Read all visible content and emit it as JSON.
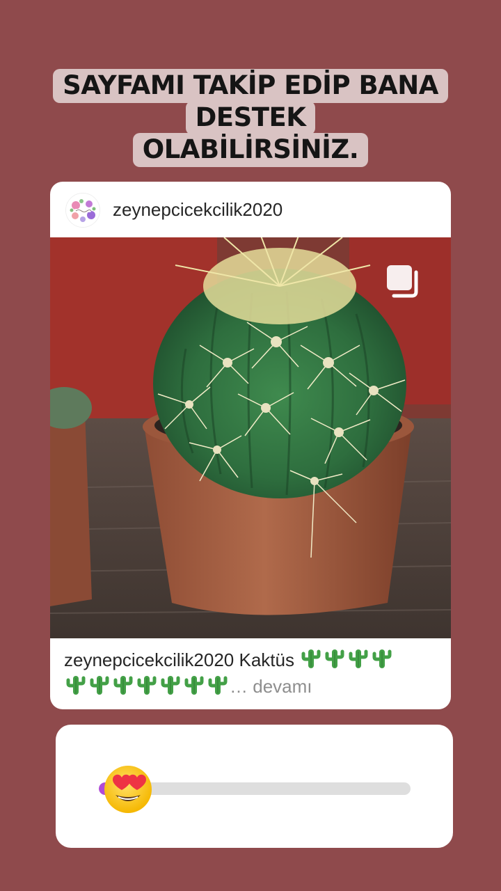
{
  "colors": {
    "background": "#8f4a4c",
    "headline_highlight": "#d9c3c3",
    "card": "#ffffff",
    "slider_track": "#dedede",
    "slider_fill": "#b04ad8"
  },
  "headline": {
    "line1": "SAYFAMI TAKİP EDİP BANA DESTEK",
    "line2": "OLABİLİRSİNİZ."
  },
  "post": {
    "username": "zeynepcicekcilik2020",
    "avatar_icon": "flower-logo-icon",
    "image_subject": "cactus-in-pot-photo",
    "multi_photo_icon": "carousel-icon",
    "caption": {
      "user": "zeynepcicekcilik2020",
      "text": "Kaktüs",
      "emoji_name": "cactus-emoji",
      "emoji_count_line1": 4,
      "emoji_count_line2": 7,
      "ellipsis": "…",
      "more": "devamı"
    }
  },
  "slider": {
    "emoji_name": "heart-eyes-emoji",
    "value": 0.0
  }
}
